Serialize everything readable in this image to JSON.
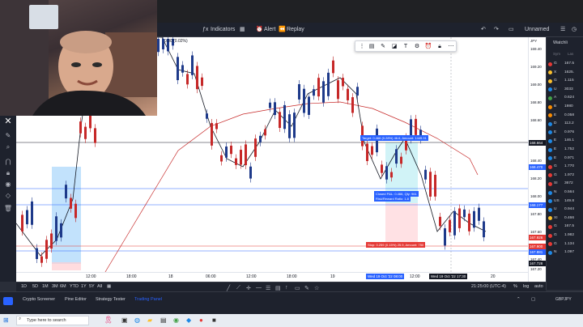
{
  "toolbar": {
    "indicators_label": "Indicators",
    "alert_label": "Alert",
    "replay_label": "Replay",
    "layout_label": "Unnamed",
    "watchlist_title": "Watchli"
  },
  "watchlist": {
    "col_sym": "Sym",
    "col_last": "Las",
    "rows": [
      {
        "sym": "G",
        "val": "167.5",
        "color": "#e53935"
      },
      {
        "sym": "X",
        "val": "1625.",
        "color": "#fbc02d"
      },
      {
        "sym": "G",
        "val": "1.115",
        "color": "#fbc02d"
      },
      {
        "sym": "U",
        "val": "3033",
        "color": "#1e88e5"
      },
      {
        "sym": "A",
        "val": "0.624",
        "color": "#43a047"
      },
      {
        "sym": "B",
        "val": "1980",
        "color": "#fb8c00"
      },
      {
        "sym": "E",
        "val": "0.058",
        "color": "#fb8c00"
      },
      {
        "sym": "D",
        "val": "113.2",
        "color": "#1e88e5"
      },
      {
        "sym": "E",
        "val": "0.976",
        "color": "#1e88e5"
      },
      {
        "sym": "E",
        "val": "146.1",
        "color": "#1e88e5"
      },
      {
        "sym": "E",
        "val": "1.752",
        "color": "#1e88e5"
      },
      {
        "sym": "E",
        "val": "0.971",
        "color": "#1e88e5"
      },
      {
        "sym": "G",
        "val": "1.770",
        "color": "#e53935"
      },
      {
        "sym": "G",
        "val": "1.972",
        "color": "#e53935"
      },
      {
        "sym": "SI",
        "val": "3672",
        "color": "#e53935"
      },
      {
        "sym": "N",
        "val": "0.564",
        "color": "#1e88e5"
      },
      {
        "sym": "US",
        "val": "149.8",
        "color": "#1e88e5"
      },
      {
        "sym": "U",
        "val": "0.944",
        "color": "#1e88e5"
      },
      {
        "sym": "XI",
        "val": "0.466",
        "color": "#fbc02d"
      },
      {
        "sym": "G",
        "val": "167.5",
        "color": "#e53935"
      },
      {
        "sym": "G",
        "val": "1.982",
        "color": "#e53935"
      },
      {
        "sym": "G",
        "val": "1.134",
        "color": "#e53935"
      },
      {
        "sym": "N",
        "val": "1.097",
        "color": "#1e88e5"
      }
    ],
    "footer_symbol": "GBPJPY"
  },
  "price_axis": {
    "currency": "JPY",
    "labels": [
      "169.40",
      "169.20",
      "169.00",
      "168.80",
      "168.60",
      "168.40",
      "168.20",
      "168.00",
      "167.80",
      "167.60",
      "167.40",
      "167.20"
    ],
    "tags": [
      {
        "text": "168.664",
        "color": "#131722"
      },
      {
        "text": "168.470",
        "color": "#2962ff"
      },
      {
        "text": "168.177",
        "color": "#2962ff"
      },
      {
        "text": "167.926",
        "color": "#e53935"
      },
      {
        "text": "167.900",
        "color": "#e53935"
      },
      {
        "text": "167.881",
        "color": "#2962ff"
      },
      {
        "text": "167.728",
        "color": "#131722"
      }
    ]
  },
  "time_axis": {
    "labels": [
      "12:00",
      "18:00",
      "18",
      "06:00",
      "12:00",
      "18:00",
      "19",
      "12:00",
      "20"
    ],
    "tag_left": "Wed 19 Oct '22   08:00",
    "tag_right": "Wed 19 Oct '22   17:30"
  },
  "chart": {
    "legend_text": "0.00 (0.02%)",
    "target_label": "Target: 0.466 (0.28%) 46.6, Amount: 1449.91",
    "closed_label": "Closed P&L: 0.466, Qty: 961",
    "rr_label": "Risk/Reward Ratio: 1.8",
    "stop_label": "Stop: 0.259 (0.15%) 25.9, Amount: 750"
  },
  "ranges": {
    "items": [
      "1D",
      "5D",
      "1M",
      "3M",
      "6M",
      "YTD",
      "1Y",
      "5Y",
      "All"
    ],
    "time": "21:25:00 (UTC-4)",
    "pct": "%",
    "log": "log",
    "auto": "auto"
  },
  "panel": {
    "tabs": [
      "Crypto Screener",
      "Pine Editor",
      "Strategy Tester",
      "Trading Panel"
    ]
  },
  "taskbar": {
    "search_placeholder": "Type here to search"
  }
}
